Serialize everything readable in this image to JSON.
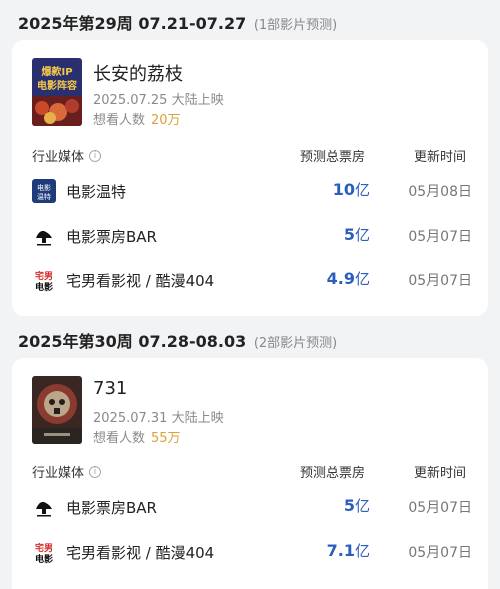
{
  "weeks": [
    {
      "header": "2025年第29周 07.21-07.27",
      "count_label": "(1部影片预测)",
      "movies": [
        {
          "title": "长安的荔枝",
          "release": "2025.07.25 大陆上映",
          "want_label": "想看人数",
          "want_value": "20万",
          "poster_text": "爆款IP 电影阵容"
        }
      ],
      "columns": {
        "media": "行业媒体",
        "prediction": "预测总票房",
        "updated": "更新时间"
      },
      "rows": [
        {
          "media": "电影温特",
          "logo": "film-winter-logo",
          "value": "10",
          "unit": "亿",
          "date": "05月08日"
        },
        {
          "media": "电影票房BAR",
          "logo": "boxoffice-bar-logo",
          "value": "5",
          "unit": "亿",
          "date": "05月07日"
        },
        {
          "media": "宅男看影视 / 酷漫404",
          "logo": "zhainan-logo",
          "value": "4.9",
          "unit": "亿",
          "date": "05月07日"
        }
      ]
    },
    {
      "header": "2025年第30周 07.28-08.03",
      "count_label": "(2部影片预测)",
      "movies": [
        {
          "title": "731",
          "release": "2025.07.31 大陆上映",
          "want_label": "想看人数",
          "want_value": "55万"
        }
      ],
      "columns": {
        "media": "行业媒体",
        "prediction": "预测总票房",
        "updated": "更新时间"
      },
      "rows": [
        {
          "media": "电影票房BAR",
          "logo": "boxoffice-bar-logo",
          "value": "5",
          "unit": "亿",
          "date": "05月07日"
        },
        {
          "media": "宅男看影视 / 酷漫404",
          "logo": "zhainan-logo",
          "value": "7.1",
          "unit": "亿",
          "date": "05月07日"
        }
      ]
    }
  ],
  "icons": {
    "info": "info-icon"
  },
  "logo_texts": {
    "zhainan": "宅男 电影",
    "winter": "电影温特"
  },
  "colors": {
    "prediction_value": "#2c5fbd",
    "want_value": "#d9a23a",
    "background": "#f2f3f5"
  }
}
